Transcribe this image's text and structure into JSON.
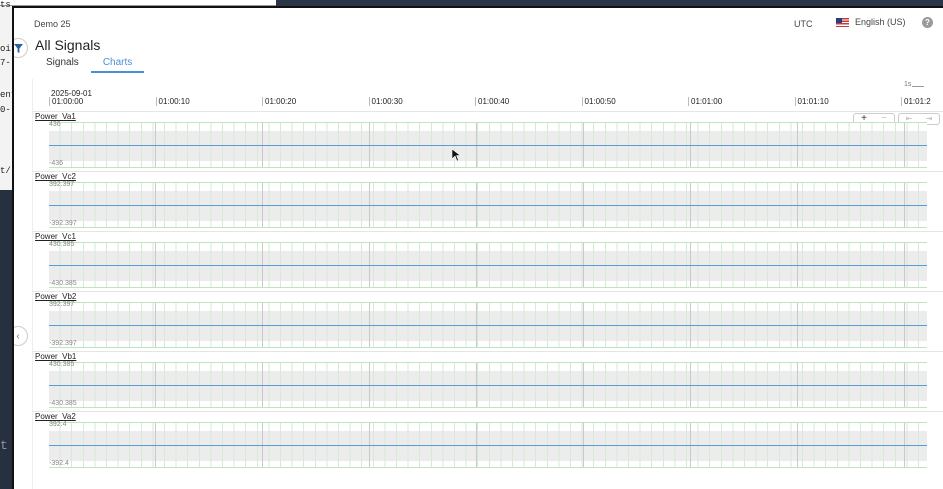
{
  "background": {
    "lines": [
      {
        "text": "ts",
        "top": 0
      },
      {
        "text": "oir",
        "top": 44
      },
      {
        "text": "7-",
        "top": 58
      },
      {
        "text": "ent",
        "top": 90
      },
      {
        "text": "0-",
        "top": 105
      },
      {
        "text": "t/",
        "top": 166
      },
      {
        "text": "t",
        "top": 438
      }
    ]
  },
  "header": {
    "org": "Demo 25",
    "timezone": "UTC",
    "language": "English (US)",
    "help": "?"
  },
  "page": {
    "title": "All Signals",
    "tabs": [
      {
        "label": "Signals",
        "active": false
      },
      {
        "label": "Charts",
        "active": true
      }
    ]
  },
  "chart_header": {
    "date": "2025-09-01",
    "ticks": [
      "01:00:00",
      "01:00:10",
      "01:00:20",
      "01:00:30",
      "01:00:40",
      "01:00:50",
      "01:01:00",
      "01:01:10",
      "01:01:2"
    ],
    "scale": "1s",
    "zoom_in": "+",
    "zoom_out": "−",
    "pan_left": "⇤",
    "pan_right": "⇥"
  },
  "signals": [
    {
      "name": "Power_Va1",
      "max": "436",
      "min": "-436"
    },
    {
      "name": "Power_Vc2",
      "max": "392.397",
      "min": "-392.397"
    },
    {
      "name": "Power_Vc1",
      "max": "430.385",
      "min": "-430.385"
    },
    {
      "name": "Power_Vb2",
      "max": "392.397",
      "min": "-392.397"
    },
    {
      "name": "Power_Vb1",
      "max": "430.385",
      "min": "-430.385"
    },
    {
      "name": "Power_Va2",
      "max": "392.4",
      "min": "-392.4"
    }
  ],
  "colors": {
    "accent": "#4a90d9",
    "series": "#5b9bd5"
  }
}
